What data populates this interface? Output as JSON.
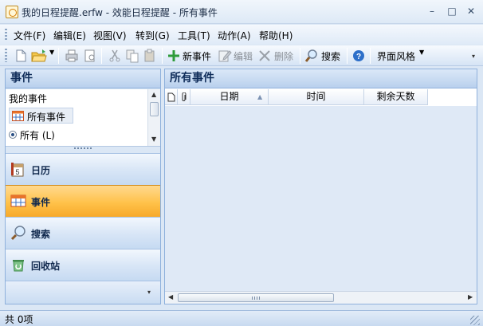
{
  "window": {
    "title": "我的日程提醒.erfw - 效能日程提醒 - 所有事件",
    "controls": [
      "–",
      "□",
      "✕"
    ]
  },
  "menu": [
    "文件(F)",
    "编辑(E)",
    "视图(V)",
    "转到(G)",
    "工具(T)",
    "动作(A)",
    "帮助(H)"
  ],
  "toolbar": {
    "new_event": "新事件",
    "edit": "编辑",
    "delete": "删除",
    "search": "搜索",
    "skin": "界面风格"
  },
  "left_panel": {
    "title": "事件",
    "my_events_header": "我的事件",
    "all_events": "所有事件",
    "radio_all": "所有 (L)",
    "nav": [
      "日历",
      "事件",
      "搜索",
      "回收站"
    ],
    "selected_nav": "事件"
  },
  "right_panel": {
    "title": "所有事件",
    "columns": [
      "日期",
      "时间",
      "剩余天数"
    ]
  },
  "status": {
    "count_text": "共 0项"
  },
  "colors": {
    "accent": "#ffc24a",
    "panel_title": "#0f2c59",
    "border": "#8fb1dc"
  }
}
